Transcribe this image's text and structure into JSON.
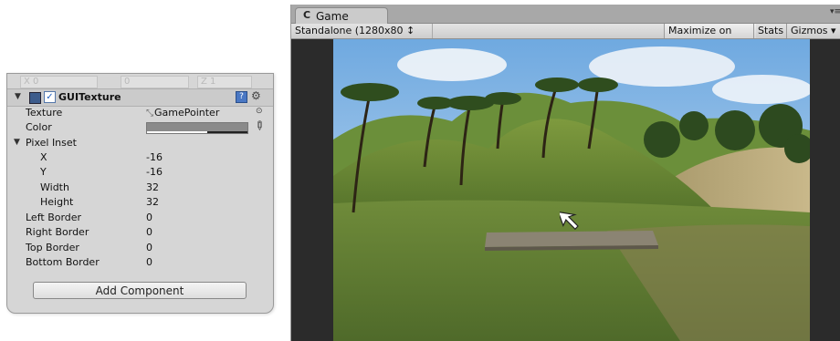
{
  "inspector": {
    "prev_row": {
      "x_label": "X",
      "x_value": "0",
      "y_value": "0",
      "z_label": "Z",
      "z_value": "1"
    },
    "component": {
      "title": "GUITexture",
      "enabled": true,
      "enabled_mark": "✓",
      "help_glyph": "?",
      "settings_glyph": "⚙",
      "fold_glyph": "▼"
    },
    "fields": {
      "texture_label": "Texture",
      "texture_value": "GamePointer",
      "color_label": "Color",
      "pixel_inset_label": "Pixel Inset",
      "x_label": "X",
      "x_value": "-16",
      "y_label": "Y",
      "y_value": "-16",
      "width_label": "Width",
      "width_value": "32",
      "height_label": "Height",
      "height_value": "32",
      "left_border_label": "Left Border",
      "left_border_value": "0",
      "right_border_label": "Right Border",
      "right_border_value": "0",
      "top_border_label": "Top Border",
      "top_border_value": "0",
      "bottom_border_label": "Bottom Border",
      "bottom_border_value": "0"
    },
    "add_component_label": "Add Component",
    "icons": {
      "texture": "texture-asset-icon",
      "color_picker": "eyedropper-icon",
      "object_selector": "object-picker-dot-icon"
    }
  },
  "game_view": {
    "tab_label": "Game",
    "tab_icon_glyph": "C",
    "tab_menu_glyph": "▾≡",
    "aspect_label": "Standalone (1280x80 ↕",
    "maximize_label": "Maximize on Play",
    "stats_label": "Stats",
    "gizmos_label": "Gizmos",
    "gizmos_arrow": "▾",
    "maximize_active": true
  },
  "colors": {
    "inspector_bg": "#d6d6d6",
    "toolbar_bg": "#d9d9d9",
    "sky": "#8fc0ea",
    "grass": "#5b7a30",
    "cursor": "#ffffff"
  }
}
